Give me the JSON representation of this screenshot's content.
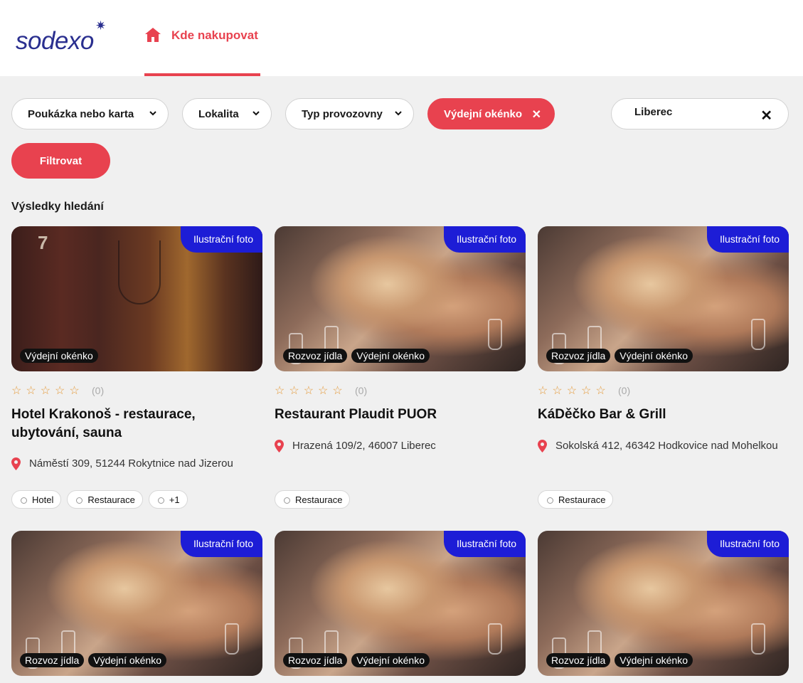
{
  "header": {
    "logo_text": "sodexo",
    "nav_label": "Kde nakupovat"
  },
  "filters": {
    "voucher_label": "Poukázka nebo karta",
    "location_label": "Lokalita",
    "type_label": "Typ provozovny",
    "active_label": "Výdejní okénko",
    "search_value": "Liberec",
    "submit_label": "Filtrovat"
  },
  "results_title": "Výsledky hledání",
  "photo_badge": "Ilustrační foto",
  "cards": [
    {
      "name": "Hotel Krakonoš - restaurace, ubytování, sauna",
      "address": "Náměstí 309, 51244 Rokytnice nad Jizerou",
      "rating_count": "(0)",
      "img_tags": [
        "Výdejní okénko"
      ],
      "tags": [
        "Hotel",
        "Restaurace",
        "+1"
      ],
      "image": "wood"
    },
    {
      "name": "Restaurant Plaudit PUOR",
      "address": "Hrazená 109/2, 46007 Liberec",
      "rating_count": "(0)",
      "img_tags": [
        "Rozvoz jídla",
        "Výdejní okénko"
      ],
      "tags": [
        "Restaurace"
      ],
      "image": "food"
    },
    {
      "name": "KáDěčko Bar & Grill",
      "address": "Sokolská 412, 46342 Hodkovice nad Mohelkou",
      "rating_count": "(0)",
      "img_tags": [
        "Rozvoz jídla",
        "Výdejní okénko"
      ],
      "tags": [
        "Restaurace"
      ],
      "image": "food"
    },
    {
      "img_tags": [
        "Rozvoz jídla",
        "Výdejní okénko"
      ],
      "image": "food"
    },
    {
      "img_tags": [
        "Rozvoz jídla",
        "Výdejní okénko"
      ],
      "image": "food"
    },
    {
      "img_tags": [
        "Rozvoz jídla",
        "Výdejní okénko"
      ],
      "image": "food"
    }
  ],
  "rating_stars": "☆☆☆☆☆",
  "colors": {
    "accent": "#e8424f",
    "brand": "#2a2f8f",
    "badge": "#1d1dd6"
  }
}
